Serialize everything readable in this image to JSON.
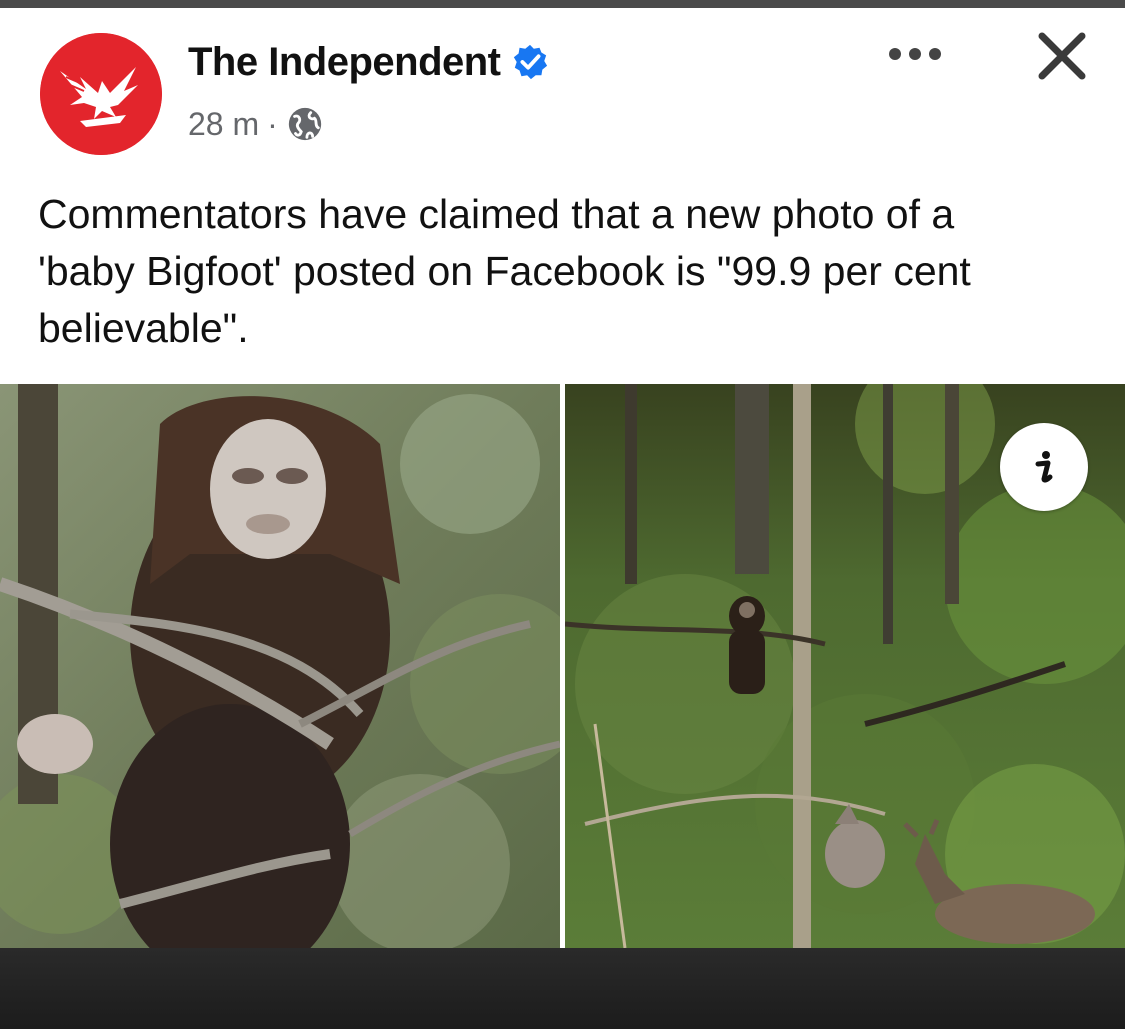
{
  "post": {
    "page_name": "The Independent",
    "time_ago": "28 m",
    "separator": "·",
    "verified_icon": "verified-badge-icon",
    "audience_icon": "globe-icon",
    "caption": "Commentators have claimed that a new photo of a\n'baby Bigfoot' posted on Facebook is \"99.9 per cent\nbelievable\"."
  },
  "actions": {
    "more_icon": "more-options-icon",
    "close_icon": "close-icon",
    "info_icon": "info-icon"
  },
  "colors": {
    "brand_red": "#e3252c",
    "verified_blue": "#1877f2",
    "meta_gray": "#65676b"
  }
}
